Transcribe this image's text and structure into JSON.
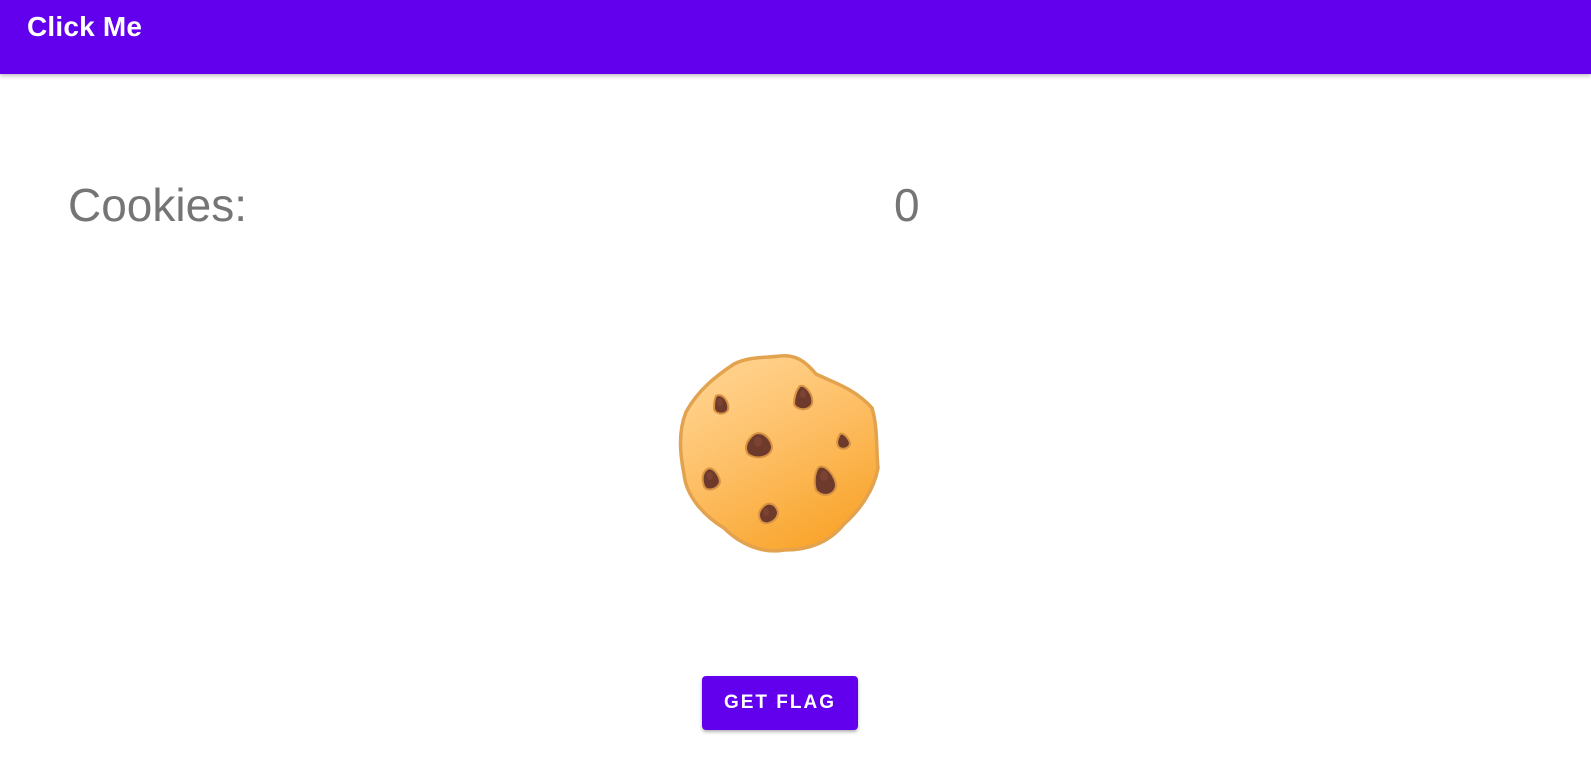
{
  "header": {
    "title": "Click Me",
    "color": "#6200ee"
  },
  "counter": {
    "label": "Cookies:",
    "value": "0"
  },
  "cookie": {
    "icon": "cookie-icon"
  },
  "flag_button": {
    "label": "GET FLAG",
    "color": "#6200ee"
  }
}
